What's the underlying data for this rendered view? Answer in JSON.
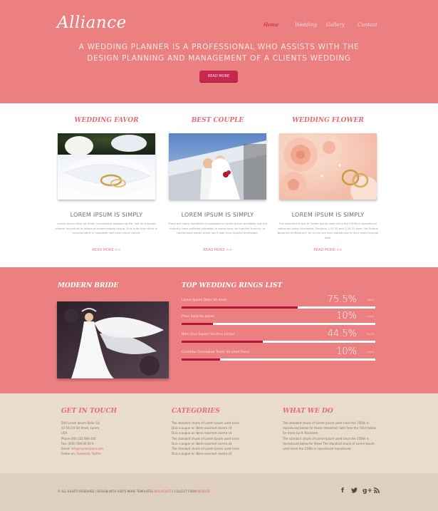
{
  "header": {
    "logo": "Alliance",
    "nav": [
      "Home",
      "Wedding",
      "Gallery",
      "Contact"
    ],
    "tagline": "A Wedding Planner is a Professional Who Assists with The Design Planning and Management of a Clients Wedding",
    "button": "Read More"
  },
  "features": [
    {
      "title": "Wedding Favor",
      "subtitle": "Lorem Ipsum is Simply",
      "body": "Lorem ipsum dolor sit amet, consectetur adipisicing elit, sed do eiusmod tempor incididunt ut labore et dolore magna aliqua. Duis aute irure dolor in reprehenderit in voluptate velit esse cillum dolore.",
      "more": "Read More >>"
    },
    {
      "title": "Best Couple",
      "subtitle": "Lorem Ipsum is Simply",
      "body": "There are many variations of passages of Lorem Ipsum available, but the majority have suffered alteration in some form, by injected humour, or randomised words which don't look even slightly believable.",
      "more": "Read More >>"
    },
    {
      "title": "Wedding Flower",
      "subtitle": "Lorem Ipsum is Simply",
      "body": "The standard chunk of Lorem Ipsum used since the 1500s is reproduced below for those interested. Sections 1.10.32 and 1.10.33 from \"de Finibus Bonorum et Malorum\" by Cicero are also reproduced in their exact original form.",
      "more": "Read More >>"
    }
  ],
  "middle": {
    "bride_title": "Modern Bride",
    "rings_title": "Top Wedding Rings List",
    "rings": [
      {
        "label": "Lorem Ipsum Dolor Sit amet",
        "pct": "75.5%",
        "small": "1,852",
        "value": 0.6
      },
      {
        "label": "Proin Sollicitis Ipsum",
        "pct": "10%",
        "small": "1,002",
        "value": 0.16
      },
      {
        "label": "Nam Quis Sapien Vel Arcu Lectus",
        "pct": "44.5%",
        "small": "99,75",
        "value": 0.42
      },
      {
        "label": "Curabitur Consequat Tortor Sit amet Purus",
        "pct": "10%",
        "small": "1,001",
        "value": 0.2
      }
    ]
  },
  "info": {
    "contact": {
      "title": "Get in Touch",
      "lines": [
        "500 Lorem Ipsum Dolor Sit,",
        "22-56-2-9 Sit Amet, Lorem,",
        "USA",
        "Phone:(00) 222 666 444",
        "Fax: (000) 000 00 00 0"
      ],
      "email_label": "Email:",
      "email": "info@mycompany.com",
      "follow_label": "Follow on:",
      "follow": "Facebook, Twitter"
    },
    "categories": {
      "title": "Categories",
      "lines": [
        "The standard chunk of Lorem Ipsum used since",
        "Duis a augue ac libero euismod viverra sit",
        "Duis a augue ac libero euismod viverra sit",
        "The standard chunk of Lorem Ipsum used since",
        "Duis a augue ac libero euismod viverra sit",
        "The standard chunk of Lorem Ipsum used since",
        "Duis a augue ac libero euismod viverra sit"
      ]
    },
    "whatwedo": {
      "title": "What We Do",
      "lines": [
        "The standard chunk of Lorem Ipsum used since the 1500s is",
        "reproduced below for those interested. Sets from the 1914 below",
        "for those by H. Rackham.",
        "The standard chunk of Lorem Ipsum used since the 1500s is",
        "reproduced below for those The standard chunk of Lorem Ipsum",
        "used since the 1500s is reproduced reproduced."
      ]
    }
  },
  "footer": {
    "copy": "© All Rights Reserved | Design with Visits More Templates",
    "link1": "W3Layouts",
    "middle": "| Collect from",
    "link2": "Website"
  },
  "colors": {
    "pink": "#ec7f80",
    "accent": "#c62850",
    "beige": "#eadccd"
  }
}
